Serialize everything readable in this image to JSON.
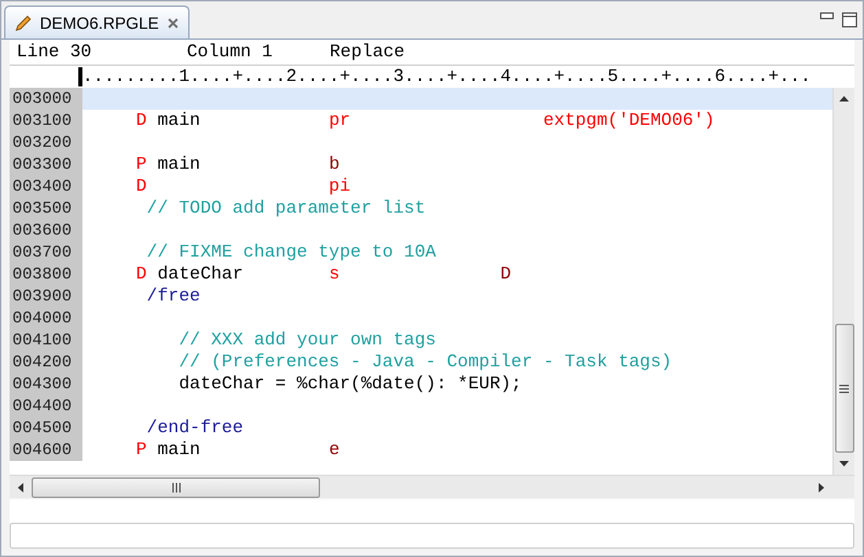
{
  "tab": {
    "title": "DEMO6.RPGLE",
    "selected": true
  },
  "status": {
    "line": "Line 30",
    "column": "Column 1",
    "mode": "Replace"
  },
  "ruler": ".........1....+....2....+....3....+....4....+....5....+....6....+...",
  "lines": [
    {
      "number": "003000",
      "selected": true
    },
    {
      "number": "003100",
      "selected": false,
      "tokens": [
        {
          "text": "     D",
          "kind": "spec"
        },
        {
          "text": " main",
          "kind": "code"
        },
        {
          "text": "            pr",
          "kind": "spec"
        },
        {
          "text": "                  extpgm('DEMO06')",
          "kind": "spec"
        }
      ]
    },
    {
      "number": "003200",
      "selected": false
    },
    {
      "number": "003300",
      "selected": false,
      "tokens": [
        {
          "text": "     P",
          "kind": "spec"
        },
        {
          "text": " main",
          "kind": "code"
        },
        {
          "text": "            b",
          "kind": "type"
        }
      ]
    },
    {
      "number": "003400",
      "selected": false,
      "tokens": [
        {
          "text": "     D",
          "kind": "spec"
        },
        {
          "text": "                 pi",
          "kind": "spec"
        }
      ]
    },
    {
      "number": "003500",
      "selected": false,
      "tokens": [
        {
          "text": "      // TODO add parameter list",
          "kind": "comment"
        }
      ]
    },
    {
      "number": "003600",
      "selected": false
    },
    {
      "number": "003700",
      "selected": false,
      "tokens": [
        {
          "text": "      // FIXME change type to 10A",
          "kind": "comment"
        }
      ]
    },
    {
      "number": "003800",
      "selected": false,
      "tokens": [
        {
          "text": "     D",
          "kind": "spec"
        },
        {
          "text": " dateChar",
          "kind": "code"
        },
        {
          "text": "        s",
          "kind": "spec"
        },
        {
          "text": "               D",
          "kind": "type"
        }
      ]
    },
    {
      "number": "003900",
      "selected": false,
      "tokens": [
        {
          "text": "      /free",
          "kind": "directive"
        }
      ]
    },
    {
      "number": "004000",
      "selected": false
    },
    {
      "number": "004100",
      "selected": false,
      "tokens": [
        {
          "text": "         // XXX add your own tags",
          "kind": "comment"
        }
      ]
    },
    {
      "number": "004200",
      "selected": false,
      "tokens": [
        {
          "text": "         // (Preferences - Java - Compiler - Task tags)",
          "kind": "comment"
        }
      ]
    },
    {
      "number": "004300",
      "selected": false,
      "tokens": [
        {
          "text": "         dateChar = %char(%date(): *EUR);",
          "kind": "code"
        }
      ]
    },
    {
      "number": "004400",
      "selected": false
    },
    {
      "number": "004500",
      "selected": false,
      "tokens": [
        {
          "text": "      /end-free",
          "kind": "directive"
        }
      ]
    },
    {
      "number": "004600",
      "selected": false,
      "tokens": [
        {
          "text": "     P",
          "kind": "spec"
        },
        {
          "text": " main",
          "kind": "code"
        },
        {
          "text": "            e",
          "kind": "type"
        }
      ]
    }
  ]
}
